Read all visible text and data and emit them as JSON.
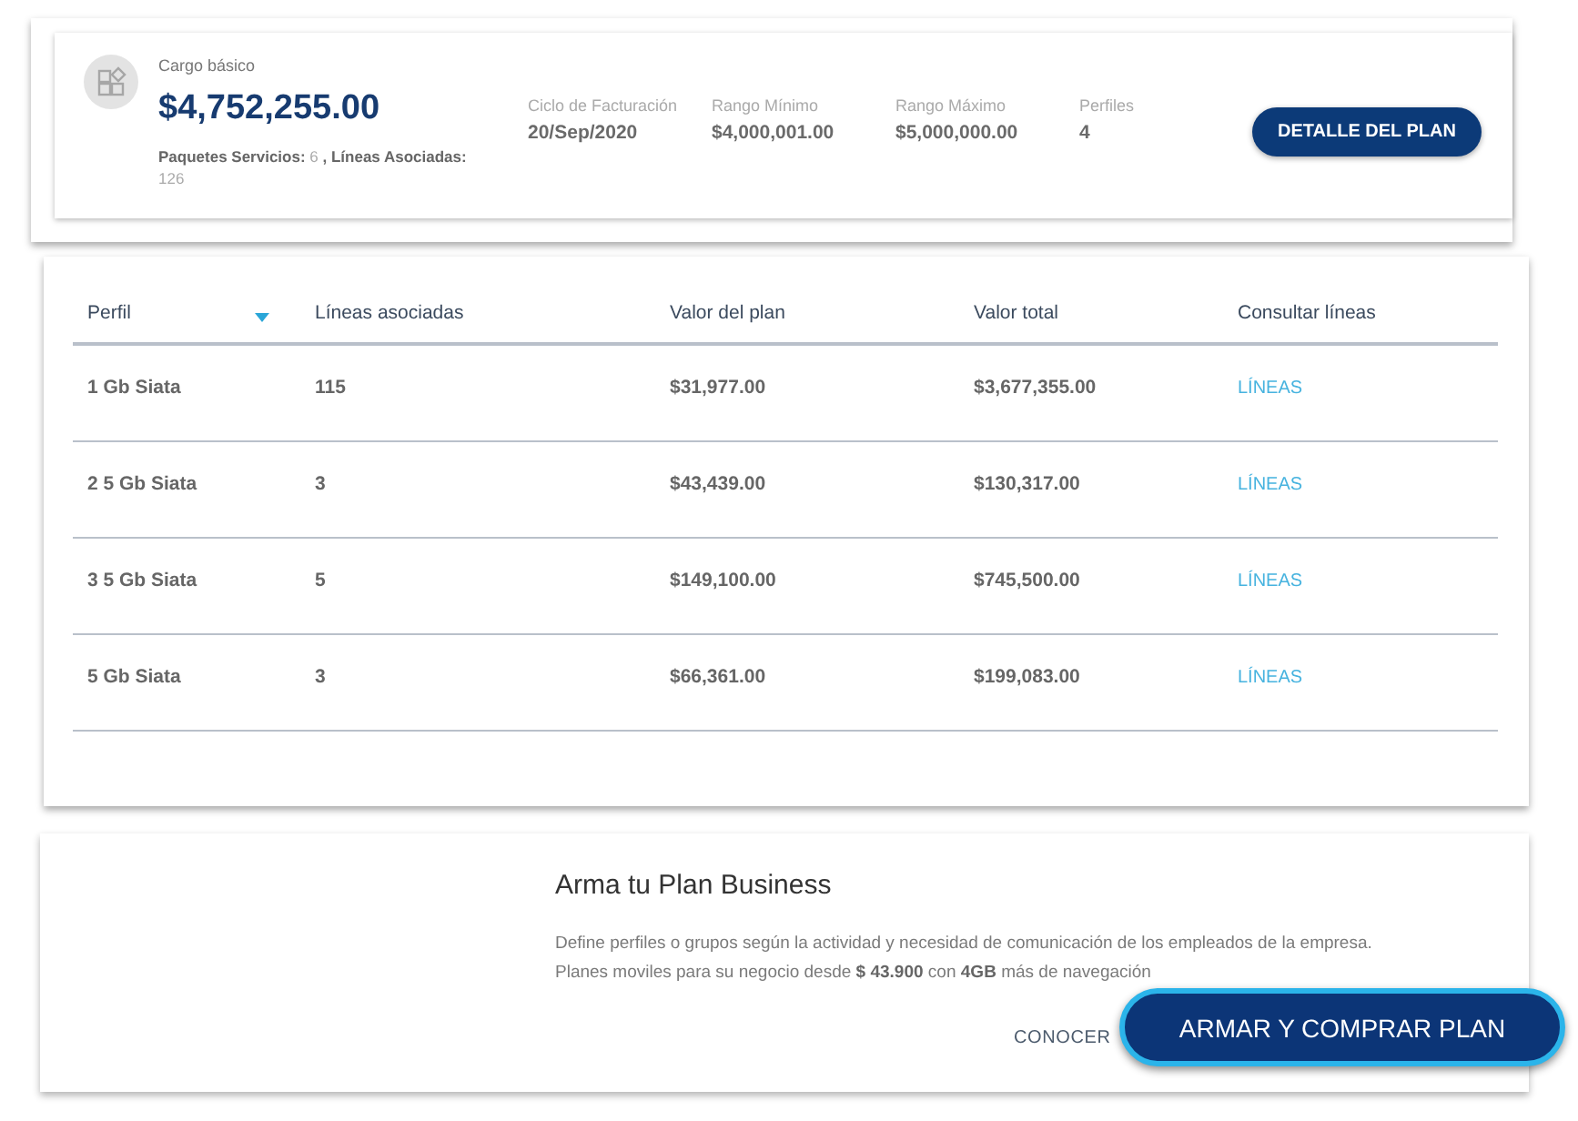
{
  "plan_card": {
    "title": "Cargo básico",
    "amount": "$4,752,255.00",
    "summary": "**Paquetes Servicios:** 6 **, Líneas Asociadas:** 126",
    "stats": [
      {
        "label": "Ciclo de Facturación",
        "value": "20/Sep/2020"
      },
      {
        "label": "Rango Mínimo",
        "value": "$4,000,001.00"
      },
      {
        "label": "Rango Máximo",
        "value": "$5,000,000.00"
      },
      {
        "label": "Perfiles",
        "value": "4"
      }
    ],
    "button": "DETALLE DEL PLAN"
  },
  "profiles_table": {
    "columns": [
      {
        "label": "Perfil",
        "sorted": true
      },
      {
        "label": "Líneas asociadas",
        "sorted": false
      },
      {
        "label": "Valor del plan",
        "sorted": false
      },
      {
        "label": "Valor total",
        "sorted": false
      },
      {
        "label": "Consultar líneas",
        "sorted": false
      }
    ],
    "rows": [
      {
        "cells": [
          "1 Gb Siata",
          "115",
          "$31,977.00",
          "$3,677,355.00"
        ],
        "link": "LÍNEAS"
      },
      {
        "cells": [
          "2 5 Gb Siata",
          "3",
          "$43,439.00",
          "$130,317.00"
        ],
        "link": "LÍNEAS"
      },
      {
        "cells": [
          "3 5 Gb Siata",
          "5",
          "$149,100.00",
          "$745,500.00"
        ],
        "link": "LÍNEAS"
      },
      {
        "cells": [
          "5 Gb Siata",
          "3",
          "$66,361.00",
          "$199,083.00"
        ],
        "link": "LÍNEAS"
      }
    ]
  },
  "promo": {
    "title": "Arma tu Plan Business",
    "description": [
      "Define perfiles o grupos según la actividad y necesidad de comunicación de los empleados de la empresa.",
      "Planes moviles para su negocio desde **$ 43.900** con **4GB** más de navegación"
    ],
    "link": "CONOCER",
    "button": "ARMAR Y COMPRAR PLAN"
  }
}
